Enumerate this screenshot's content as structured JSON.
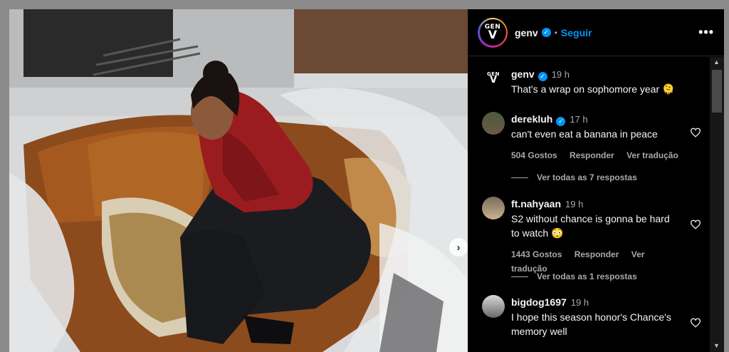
{
  "post": {
    "username": "genv",
    "dot": "•",
    "follow_label": "Seguir",
    "more_label": "•••",
    "avatar_logo_top": "GEN",
    "avatar_logo_bottom": "V"
  },
  "caption": {
    "username": "genv",
    "time": "19 h",
    "text": "That's a wrap on sophomore year 🫠"
  },
  "comments": [
    {
      "username": "derekluh",
      "verified": true,
      "time": "17 h",
      "text": "can't even eat a banana in peace",
      "likes": "504 Gostos",
      "reply_label": "Responder",
      "translate_label": "Ver tradução",
      "replies_label": "Ver todas as 7 respostas"
    },
    {
      "username": "ft.nahyaan",
      "verified": false,
      "time": "19 h",
      "text": "S2 without chance is gonna be hard to watch 😳",
      "likes": "1443 Gostos",
      "reply_label": "Responder",
      "translate_label": "Ver tradução",
      "replies_label": "Ver todas as 1 respostas"
    },
    {
      "username": "bigdog1697",
      "verified": false,
      "time": "19 h",
      "text": "I hope this season honor's Chance's memory well"
    }
  ],
  "icons": {
    "verified": "verified-badge-icon",
    "heart": "heart-icon",
    "next": "chevron-right-icon"
  },
  "colors": {
    "accent": "#0095f6",
    "panel_bg": "#000000",
    "muted_text": "#a8a8a8"
  }
}
